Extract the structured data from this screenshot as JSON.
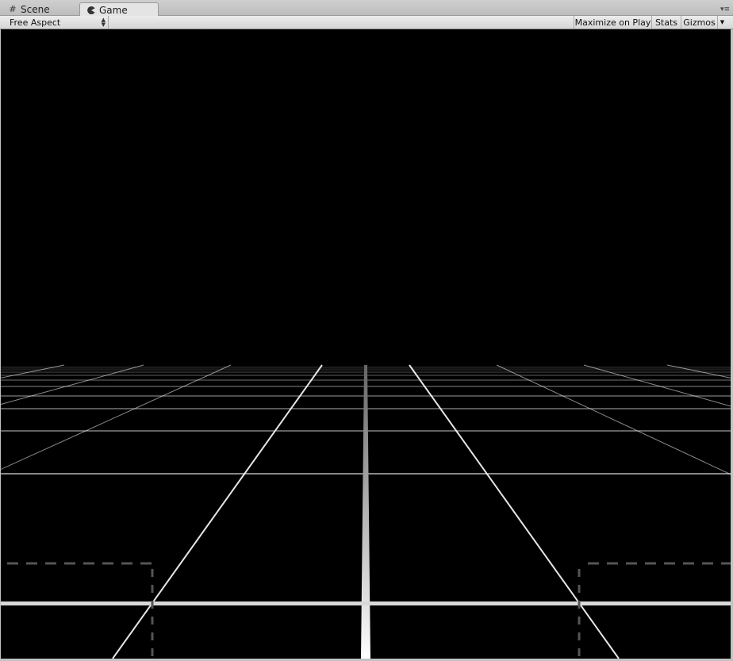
{
  "tabs": [
    {
      "label": "Scene",
      "icon": "scene-grid-icon"
    },
    {
      "label": "Game",
      "icon": "pacman-game-icon",
      "active": true
    }
  ],
  "toolbar": {
    "aspect_label": "Free Aspect",
    "maximize_label": "Maximize on Play",
    "stats_label": "Stats",
    "gizmos_label": "Gizmos"
  },
  "icons": {
    "tab_menu": "tab-menu-icon",
    "aspect_dropdown": "dropdown-arrows-icon",
    "gizmos_dropdown": "dropdown-arrow-icon"
  },
  "colors": {
    "chrome": "#c2c2c2",
    "viewport": "#000000",
    "grid_line": "#ffffff",
    "dashed_bounds": "#555555"
  }
}
